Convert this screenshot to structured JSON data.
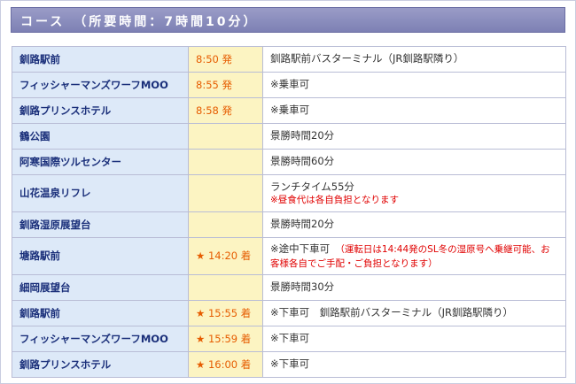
{
  "header": {
    "title": "コース　（所要時間：7時間10分）"
  },
  "rows": [
    {
      "name": "釧路駅前",
      "star": "",
      "time": "8:50 発",
      "note": "釧路駅前バスターミナル（JR釧路駅隣り）",
      "note_red": ""
    },
    {
      "name": "フィッシャーマンズワーフMOO",
      "star": "",
      "time": "8:55 発",
      "note": "※乗車可",
      "note_red": ""
    },
    {
      "name": "釧路プリンスホテル",
      "star": "",
      "time": "8:58 発",
      "note": "※乗車可",
      "note_red": ""
    },
    {
      "name": "鶴公園",
      "star": "",
      "time": "",
      "note": "景勝時間20分",
      "note_red": ""
    },
    {
      "name": "阿寒国際ツルセンター",
      "star": "",
      "time": "",
      "note": "景勝時間60分",
      "note_red": ""
    },
    {
      "name": "山花温泉リフレ",
      "star": "",
      "time": "",
      "note": "ランチタイム55分",
      "note_red": "※昼食代は各自負担となります"
    },
    {
      "name": "釧路湿原展望台",
      "star": "",
      "time": "",
      "note": "景勝時間20分",
      "note_red": ""
    },
    {
      "name": "塘路駅前",
      "star": "★",
      "time": "14:20 着",
      "note": "※途中下車可　",
      "note_red": "（運転日は14:44発のSL冬の湿原号へ乗継可能、お客様各自でご手配・ご負担となります）"
    },
    {
      "name": "細岡展望台",
      "star": "",
      "time": "",
      "note": "景勝時間30分",
      "note_red": ""
    },
    {
      "name": "釧路駅前",
      "star": "★",
      "time": "15:55 着",
      "note": "※下車可　釧路駅前バスターミナル（JR釧路駅隣り）",
      "note_red": ""
    },
    {
      "name": "フィッシャーマンズワーフMOO",
      "star": "★",
      "time": "15:59 着",
      "note": "※下車可",
      "note_red": ""
    },
    {
      "name": "釧路プリンスホテル",
      "star": "★",
      "time": "16:00 着",
      "note": "※下車可",
      "note_red": ""
    }
  ]
}
